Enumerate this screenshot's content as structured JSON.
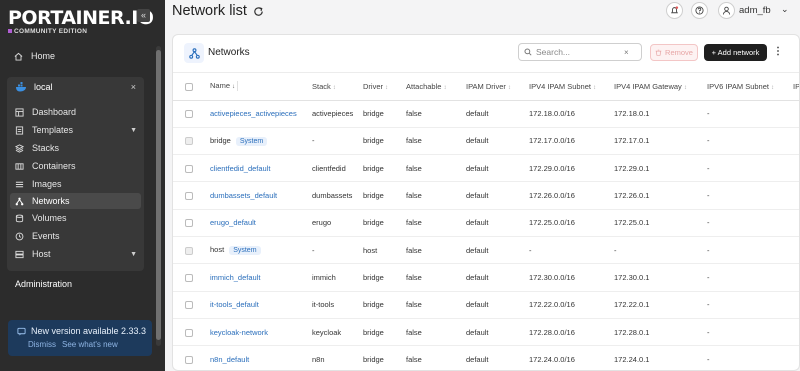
{
  "brand": {
    "name": "PORTAINER.IO",
    "edition": "COMMUNITY EDITION"
  },
  "sidebar": {
    "home_label": "Home",
    "environment": {
      "name": "local"
    },
    "items": [
      {
        "label": "Dashboard",
        "icon": "dashboard-icon"
      },
      {
        "label": "Templates",
        "icon": "templates-icon",
        "has_children": true
      },
      {
        "label": "Stacks",
        "icon": "stacks-icon"
      },
      {
        "label": "Containers",
        "icon": "containers-icon"
      },
      {
        "label": "Images",
        "icon": "images-icon"
      },
      {
        "label": "Networks",
        "icon": "networks-icon",
        "active": true
      },
      {
        "label": "Volumes",
        "icon": "volumes-icon"
      },
      {
        "label": "Events",
        "icon": "events-icon"
      },
      {
        "label": "Host",
        "icon": "host-icon",
        "has_children": true
      }
    ],
    "administration_label": "Administration",
    "update": {
      "title": "New version available 2.33.3",
      "dismiss": "Dismiss",
      "see_whats_new": "See what's new"
    }
  },
  "header": {
    "title": "Network list",
    "user": "adm_fb"
  },
  "panel": {
    "title": "Networks",
    "search_placeholder": "Search...",
    "remove_label": "Remove",
    "add_label": "+ Add network",
    "columns": [
      "Name",
      "Stack",
      "Driver",
      "Attachable",
      "IPAM Driver",
      "IPV4 IPAM Subnet",
      "IPV4 IPAM Gateway",
      "IPV6 IPAM Subnet",
      "IP"
    ],
    "rows": [
      {
        "name": "activepieces_activepieces",
        "badge": "",
        "stack": "activepieces",
        "driver": "bridge",
        "attachable": "false",
        "ipam_driver": "default",
        "subnet": "172.18.0.0/16",
        "gateway": "172.18.0.1",
        "ipv6_subnet": "-"
      },
      {
        "name": "bridge",
        "badge": "System",
        "stack": "-",
        "driver": "bridge",
        "attachable": "false",
        "ipam_driver": "default",
        "subnet": "172.17.0.0/16",
        "gateway": "172.17.0.1",
        "ipv6_subnet": "-"
      },
      {
        "name": "clientfedid_default",
        "badge": "",
        "stack": "clientfedid",
        "driver": "bridge",
        "attachable": "false",
        "ipam_driver": "default",
        "subnet": "172.29.0.0/16",
        "gateway": "172.29.0.1",
        "ipv6_subnet": "-"
      },
      {
        "name": "dumbassets_default",
        "badge": "",
        "stack": "dumbassets",
        "driver": "bridge",
        "attachable": "false",
        "ipam_driver": "default",
        "subnet": "172.26.0.0/16",
        "gateway": "172.26.0.1",
        "ipv6_subnet": "-"
      },
      {
        "name": "erugo_default",
        "badge": "",
        "stack": "erugo",
        "driver": "bridge",
        "attachable": "false",
        "ipam_driver": "default",
        "subnet": "172.25.0.0/16",
        "gateway": "172.25.0.1",
        "ipv6_subnet": "-"
      },
      {
        "name": "host",
        "badge": "System",
        "stack": "-",
        "driver": "host",
        "attachable": "false",
        "ipam_driver": "default",
        "subnet": "-",
        "gateway": "-",
        "ipv6_subnet": "-"
      },
      {
        "name": "immich_default",
        "badge": "",
        "stack": "immich",
        "driver": "bridge",
        "attachable": "false",
        "ipam_driver": "default",
        "subnet": "172.30.0.0/16",
        "gateway": "172.30.0.1",
        "ipv6_subnet": "-"
      },
      {
        "name": "it-tools_default",
        "badge": "",
        "stack": "it-tools",
        "driver": "bridge",
        "attachable": "false",
        "ipam_driver": "default",
        "subnet": "172.22.0.0/16",
        "gateway": "172.22.0.1",
        "ipv6_subnet": "-"
      },
      {
        "name": "keycloak-network",
        "badge": "",
        "stack": "keycloak",
        "driver": "bridge",
        "attachable": "false",
        "ipam_driver": "default",
        "subnet": "172.28.0.0/16",
        "gateway": "172.28.0.1",
        "ipv6_subnet": "-"
      },
      {
        "name": "n8n_default",
        "badge": "",
        "stack": "n8n",
        "driver": "bridge",
        "attachable": "false",
        "ipam_driver": "default",
        "subnet": "172.24.0.0/16",
        "gateway": "172.24.0.1",
        "ipv6_subnet": "-"
      }
    ]
  },
  "colors": {
    "sidebar_bg": "#2c2c2c",
    "link": "#2a6ebb",
    "update_bg": "#1d3a5c",
    "badge_bg": "#e8f0fb"
  }
}
